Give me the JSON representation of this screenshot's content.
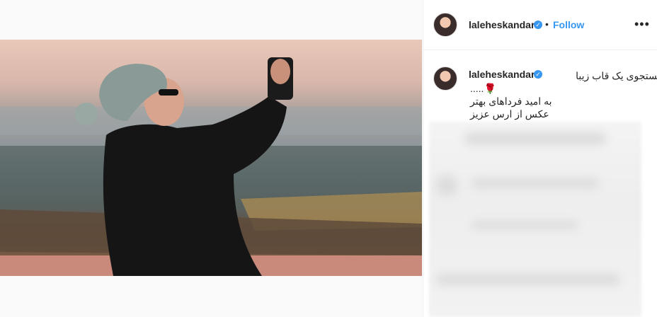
{
  "post": {
    "username": "laleheskandari",
    "follow_label": "Follow",
    "separator": "•",
    "more_label": "•••"
  },
  "caption": {
    "username": "laleheskandari",
    "lines": [
      "در جستجوی یک قاب زیبا",
      "🌹.....",
      "به امید فرداهای بهتر",
      "عکس از ارس عزیز"
    ]
  },
  "icons": {
    "verified": "verified-badge-icon",
    "more": "more-options-icon"
  },
  "colors": {
    "accent": "#3897f0",
    "text": "#262626",
    "border": "#efefef"
  }
}
